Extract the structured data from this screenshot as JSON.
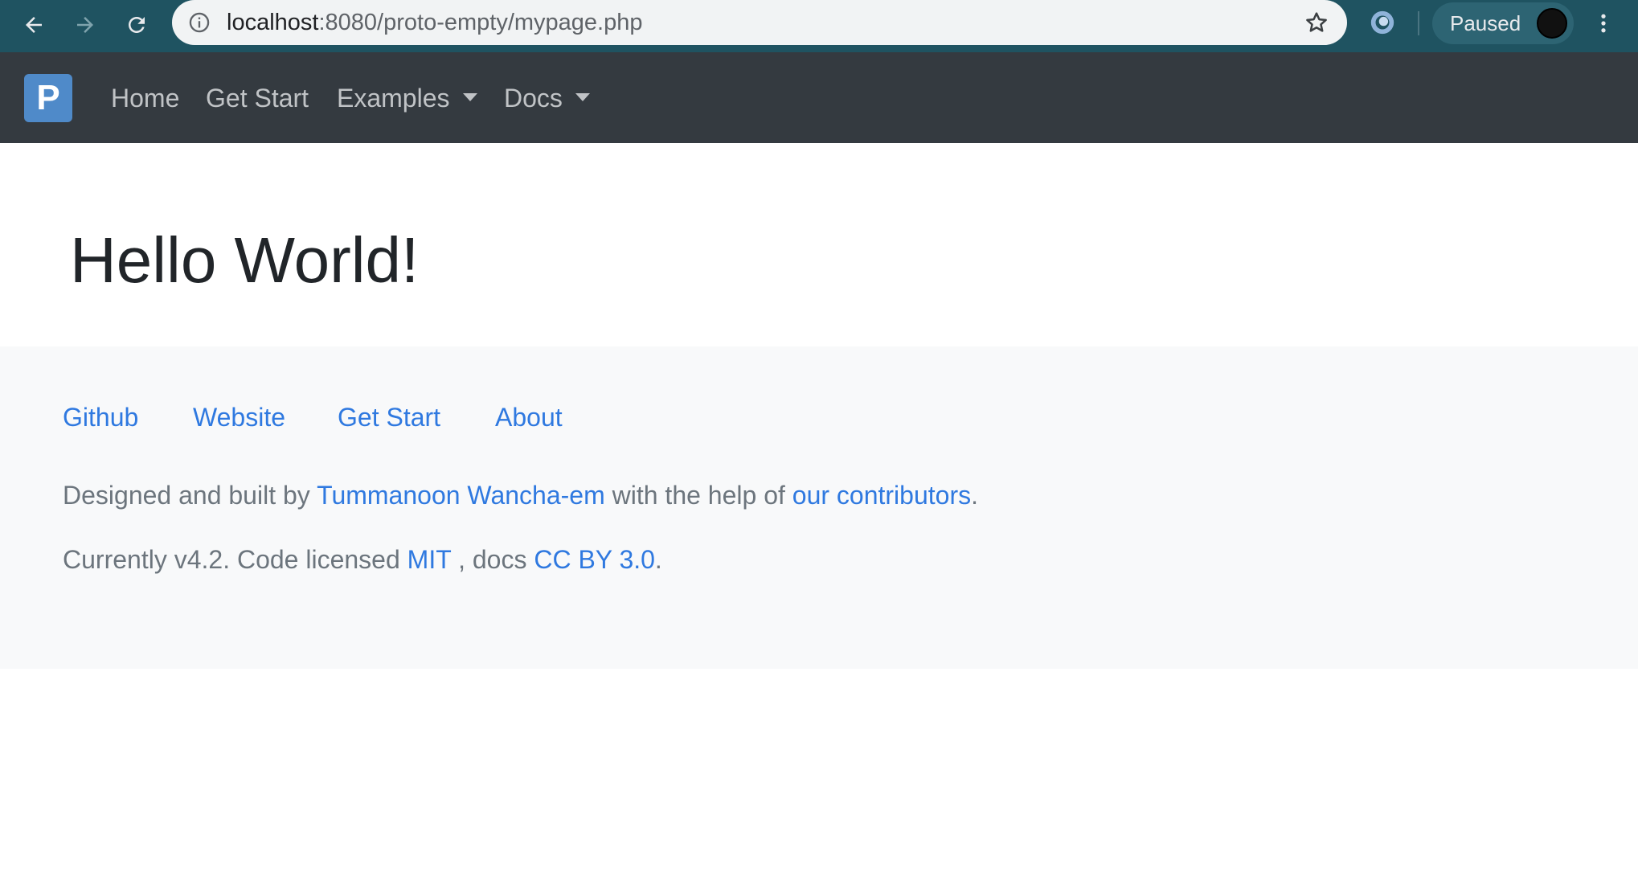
{
  "browser": {
    "url_host": "localhost",
    "url_rest": ":8080/proto-empty/mypage.php",
    "profile_status": "Paused"
  },
  "navbar": {
    "brand_letter": "P",
    "items": [
      {
        "label": "Home"
      },
      {
        "label": "Get Start"
      },
      {
        "label": "Examples"
      },
      {
        "label": "Docs"
      }
    ]
  },
  "main": {
    "title": "Hello World!"
  },
  "footer": {
    "links": [
      {
        "label": "Github"
      },
      {
        "label": "Website"
      },
      {
        "label": "Get Start"
      },
      {
        "label": "About"
      }
    ],
    "credits": {
      "prefix": "Designed and built by ",
      "author": "Tummanoon Wancha-em",
      "middle": " with the help of ",
      "contributors": "our contributors",
      "suffix": "."
    },
    "license": {
      "prefix": "Currently v4.2. Code licensed ",
      "code_license": "MIT",
      "middle": " , docs ",
      "docs_license": "CC BY 3.0",
      "suffix": "."
    }
  },
  "colors": {
    "chrome_bar": "#1f5361",
    "navbar": "#343a40",
    "brand": "#4f8ac9",
    "link": "#2f79e0",
    "footer_bg": "#f8f9fa"
  }
}
